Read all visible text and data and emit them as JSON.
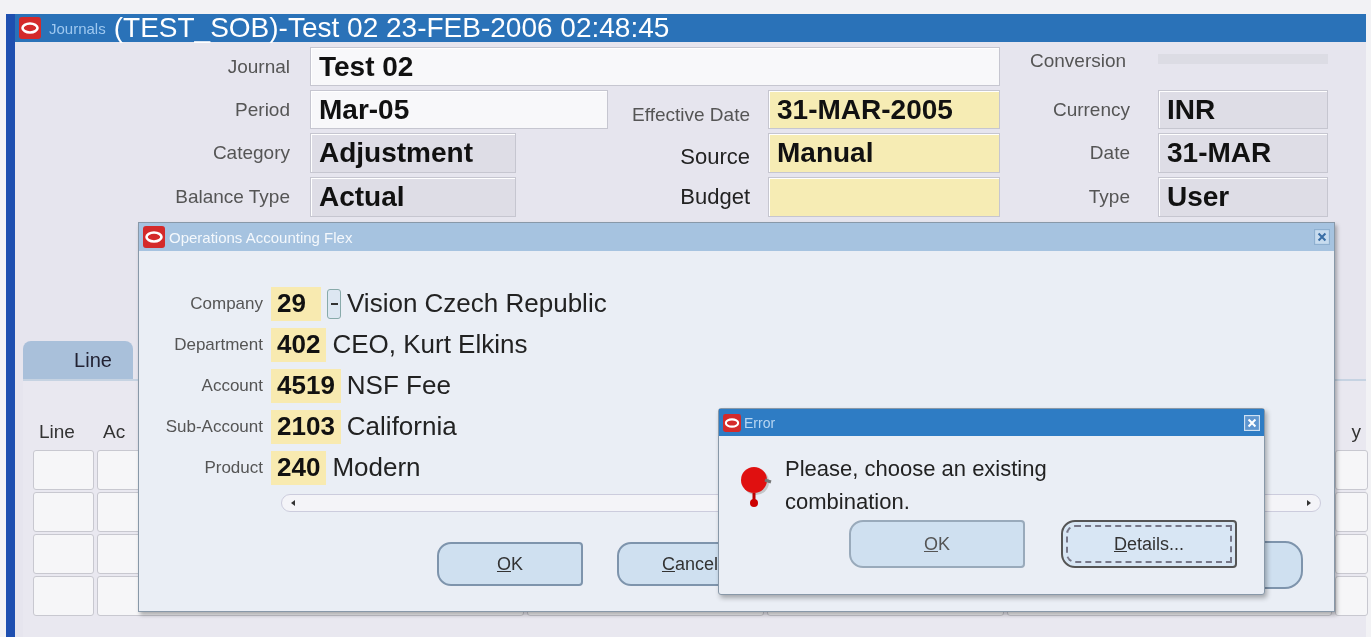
{
  "window": {
    "app_label": "Journals",
    "title": "(TEST_SOB)-Test 02 23-FEB-2006 02:48:45"
  },
  "header": {
    "journal": {
      "label": "Journal",
      "value": "Test 02"
    },
    "period": {
      "label": "Period",
      "value": "Mar-05"
    },
    "category": {
      "label": "Category",
      "value": "Adjustment"
    },
    "balance_type": {
      "label": "Balance Type",
      "value": "Actual"
    },
    "effective_date": {
      "label": "Effective Date",
      "value": "31-MAR-2005"
    },
    "source": {
      "label": "Source",
      "value": "Manual"
    },
    "budget": {
      "label": "Budget"
    }
  },
  "conversion": {
    "label": "Conversion",
    "currency": {
      "label": "Currency",
      "value": "INR"
    },
    "date": {
      "label": "Date",
      "value": "31-MAR"
    },
    "type": {
      "label": "Type",
      "value": "User"
    }
  },
  "lines_tab": {
    "label": "Line"
  },
  "lines_table": {
    "columns": [
      "Line",
      "Ac"
    ],
    "right_column": "y"
  },
  "flex_dialog": {
    "title": "Operations Accounting Flex",
    "segments": [
      {
        "label": "Company",
        "code": "29",
        "description": "Vision Czech Republic",
        "list_button": true
      },
      {
        "label": "Department",
        "code": "402",
        "description": "CEO, Kurt Elkins",
        "list_button": false
      },
      {
        "label": "Account",
        "code": "4519",
        "description": "NSF Fee",
        "list_button": false
      },
      {
        "label": "Sub-Account",
        "code": "2103",
        "description": "California",
        "list_button": false
      },
      {
        "label": "Product",
        "code": "240",
        "description": "Modern",
        "list_button": false
      }
    ],
    "buttons": [
      "OK",
      "Cancel"
    ]
  },
  "error_dialog": {
    "title": "Error",
    "message": "Please, choose an existing combination.",
    "buttons": [
      {
        "label": "OK",
        "focused": false
      },
      {
        "label": "Details...",
        "focused": true
      }
    ]
  }
}
